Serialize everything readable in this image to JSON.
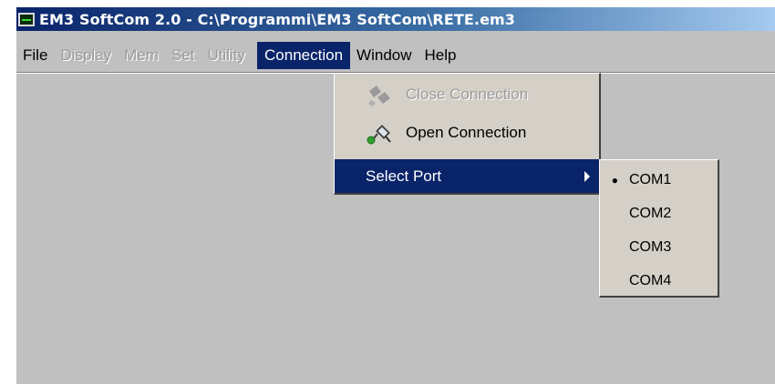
{
  "window": {
    "title": "EM3 SoftCom 2.0 - C:\\Programmi\\EM3 SoftCom\\RETE.em3"
  },
  "menubar": {
    "items": [
      {
        "label": "File",
        "enabled": true
      },
      {
        "label": "Display",
        "enabled": false
      },
      {
        "label": "Mem",
        "enabled": false
      },
      {
        "label": "Set",
        "enabled": false
      },
      {
        "label": "Utility",
        "enabled": false
      },
      {
        "label": "Connection",
        "enabled": true,
        "active": true
      },
      {
        "label": "Window",
        "enabled": true
      },
      {
        "label": "Help",
        "enabled": true
      }
    ]
  },
  "connection_menu": {
    "items": [
      {
        "label": "Close Connection",
        "icon": "close-connection-icon",
        "enabled": false
      },
      {
        "label": "Open Connection",
        "icon": "open-connection-icon",
        "enabled": true
      },
      {
        "label": "Select Port",
        "enabled": true,
        "highlighted": true,
        "has_submenu": true
      }
    ]
  },
  "port_menu": {
    "selected": "COM1",
    "items": [
      {
        "label": "COM1",
        "selected": true
      },
      {
        "label": "COM2",
        "selected": false
      },
      {
        "label": "COM3",
        "selected": false
      },
      {
        "label": "COM4",
        "selected": false
      }
    ],
    "bullet": "●"
  },
  "colors": {
    "workspace": "#c0c0c0",
    "menu_bg": "#d4d0c8",
    "highlight": "#0a246a",
    "disabled_text": "#9a9a9a"
  }
}
